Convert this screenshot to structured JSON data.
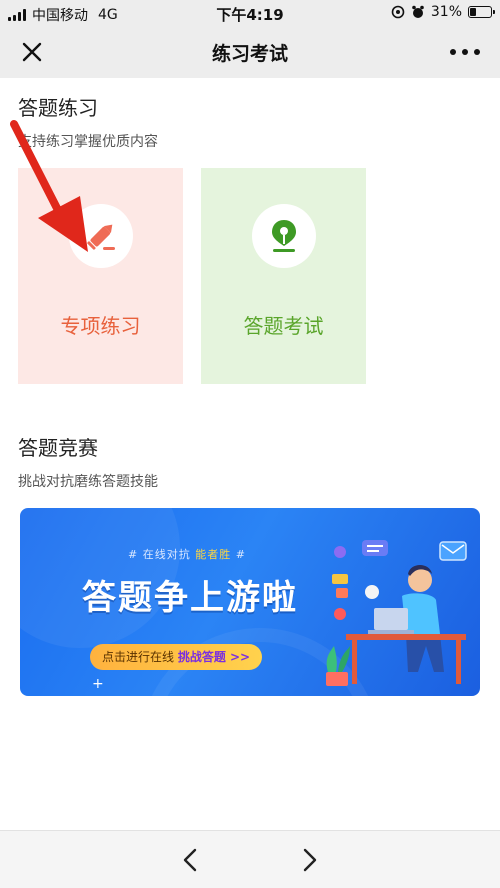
{
  "status_bar": {
    "carrier": "中国移动",
    "network": "4G",
    "time": "下午4:19",
    "battery_percent": "31%",
    "battery_level": 0.31
  },
  "nav": {
    "title": "练习考试",
    "close_icon": "close-icon",
    "more_icon": "more-dots-icon"
  },
  "practice": {
    "title": "答题练习",
    "desc": "支持练习掌握优质内容",
    "cards": [
      {
        "label": "专项练习",
        "icon": "pencil-icon",
        "color": "#e8613c",
        "bg": "#fde8e5"
      },
      {
        "label": "答题考试",
        "icon": "pen-nib-icon",
        "color": "#5aa52b",
        "bg": "#e5f4dd"
      }
    ]
  },
  "competition": {
    "title": "答题竞赛",
    "desc": "挑战对抗磨练答题技能",
    "banner": {
      "tagline_prefix": "# 在线对抗 ",
      "tagline_highlight": "能者胜",
      "tagline_suffix": " #",
      "headline": "答题争上游啦",
      "cta_prefix": "点击进行在线 ",
      "cta_highlight": "挑战答题 >>"
    }
  },
  "bottom_bar": {
    "back_icon": "chevron-left-icon",
    "forward_icon": "chevron-right-icon"
  },
  "colors": {
    "accent_red": "#e8613c",
    "accent_green": "#5aa52b",
    "banner_blue": "#1a6df0"
  }
}
